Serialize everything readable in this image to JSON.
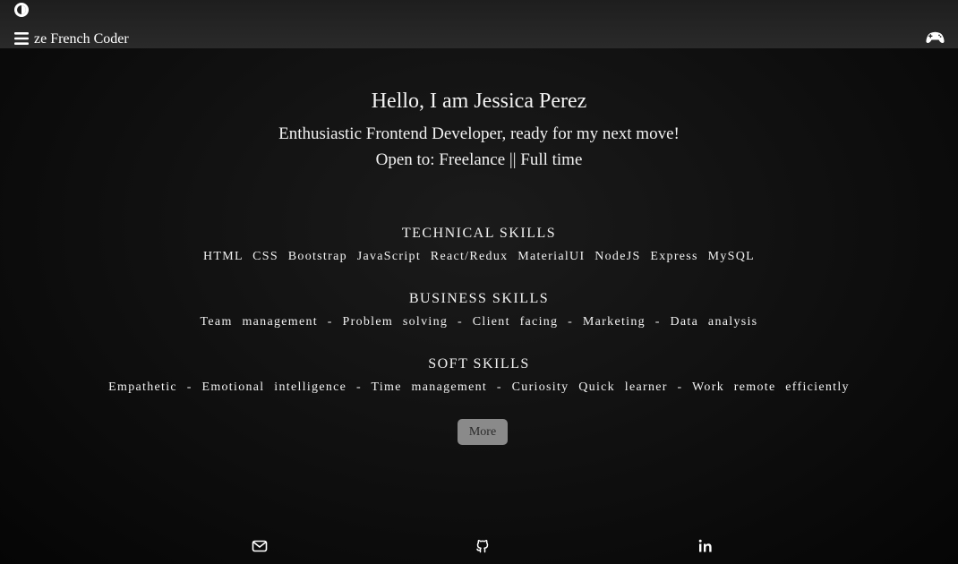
{
  "header": {
    "brand": "ze French Coder",
    "icons": [
      "theme-toggle-icon",
      "menu-icon",
      "game-controller-icon"
    ]
  },
  "hero": {
    "greeting": "Hello, I am Jessica Perez",
    "tagline": "Enthusiastic Frontend Developer, ready for my next move!",
    "open_to": "Open to: Freelance || Full time"
  },
  "skills": [
    {
      "title": "TECHNICAL SKILLS",
      "items": "HTML CSS Bootstrap JavaScript React/Redux MaterialUI NodeJS Express MySQL"
    },
    {
      "title": "BUSINESS SKILLS",
      "items": "Team management - Problem solving - Client facing - Marketing - Data analysis"
    },
    {
      "title": "SOFT SKILLS",
      "items": "Empathetic - Emotional intelligence - Time management - Curiosity Quick learner - Work remote efficiently"
    }
  ],
  "more_button": "More",
  "footer": {
    "icons": [
      "email-icon",
      "github-icon",
      "linkedin-icon"
    ]
  }
}
